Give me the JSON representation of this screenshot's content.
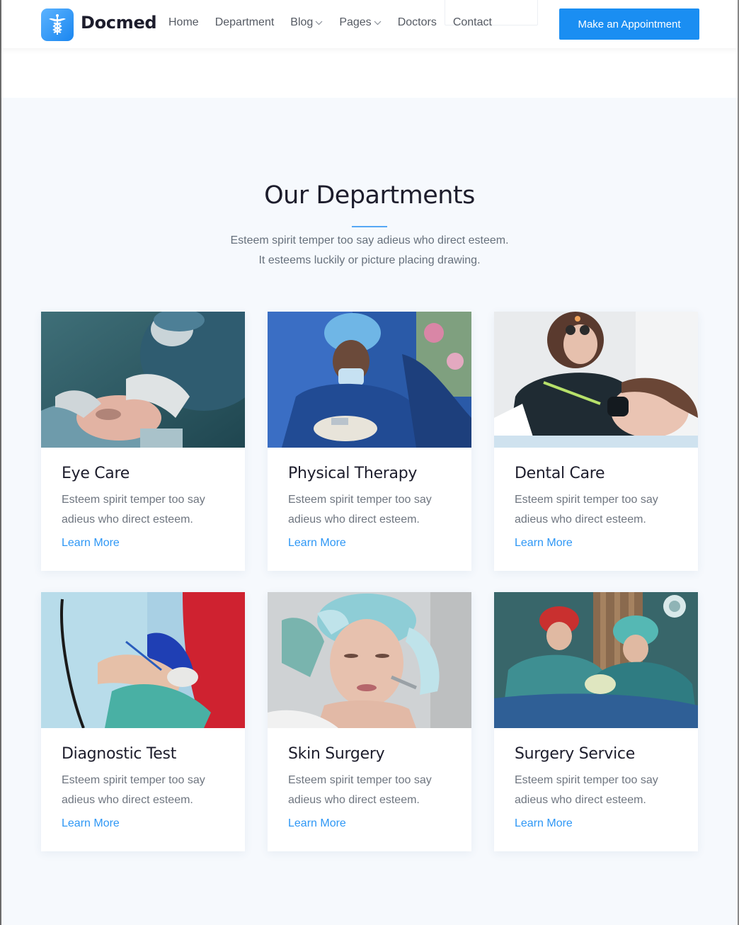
{
  "header": {
    "brand": "Docmed",
    "nav": [
      {
        "label": "Home",
        "has_dropdown": false
      },
      {
        "label": "Department",
        "has_dropdown": false
      },
      {
        "label": "Blog",
        "has_dropdown": true
      },
      {
        "label": "Pages",
        "has_dropdown": true
      },
      {
        "label": "Doctors",
        "has_dropdown": false
      },
      {
        "label": "Contact",
        "has_dropdown": false
      }
    ],
    "cta_label": "Make an Appointment",
    "logo_icon": "caduceus-icon"
  },
  "section": {
    "title": "Our Departments",
    "subtitle_lines": [
      "Esteem spirit temper too say adieus who direct esteem.",
      "It esteems luckily or picture placing drawing."
    ]
  },
  "departments": [
    {
      "title": "Eye Care",
      "description": "Esteem spirit temper too say adieus who direct esteem.",
      "link": "Learn More",
      "image": "eye-surgery-photo"
    },
    {
      "title": "Physical Therapy",
      "description": "Esteem spirit temper too say adieus who direct esteem.",
      "link": "Learn More",
      "image": "surgical-team-photo"
    },
    {
      "title": "Dental Care",
      "description": "Esteem spirit temper too say adieus who direct esteem.",
      "link": "Learn More",
      "image": "dentist-photo"
    },
    {
      "title": "Diagnostic Test",
      "description": "Esteem spirit temper too say adieus who direct esteem.",
      "link": "Learn More",
      "image": "patient-iv-photo"
    },
    {
      "title": "Skin Surgery",
      "description": "Esteem spirit temper too say adieus who direct esteem.",
      "link": "Learn More",
      "image": "facial-treatment-photo"
    },
    {
      "title": "Surgery Service",
      "description": "Esteem spirit temper too say adieus who direct esteem.",
      "link": "Learn More",
      "image": "operating-room-photo"
    }
  ],
  "colors": {
    "accent": "#1a8ef2",
    "link": "#2e97f5",
    "heading": "#1d1d2c",
    "section_bg": "#f6f9fd"
  }
}
